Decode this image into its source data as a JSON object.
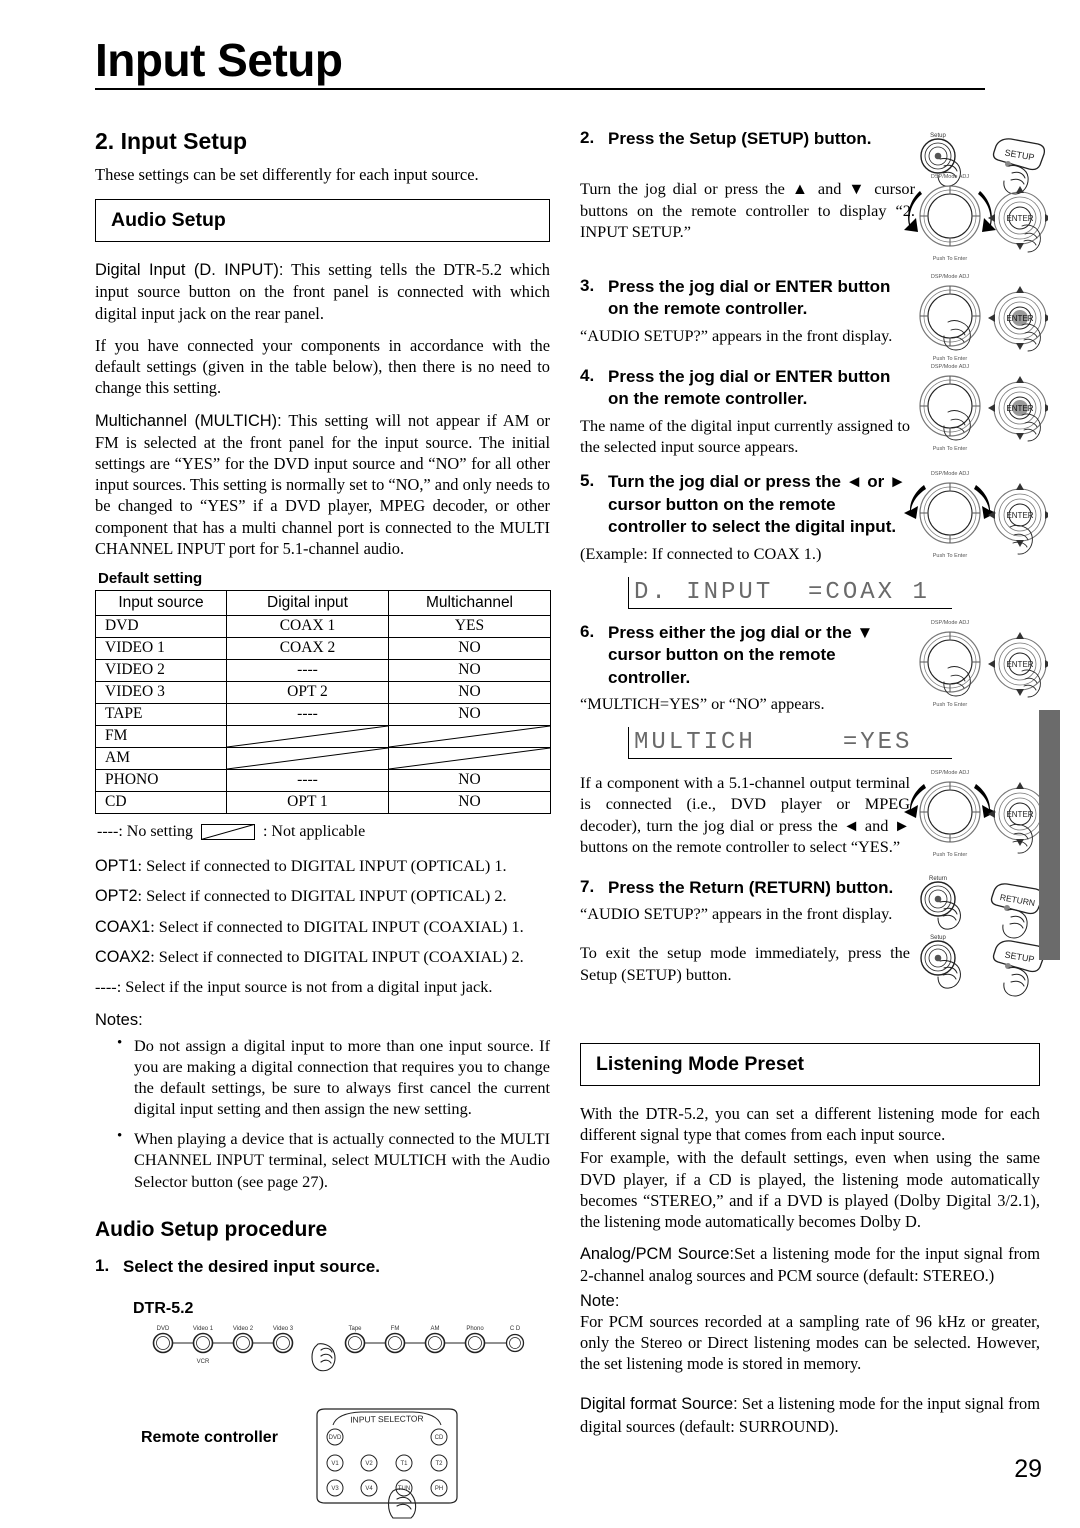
{
  "masthead": {
    "title": "Input Setup"
  },
  "left": {
    "section_title": "2. Input Setup",
    "section_lead": "These settings can be set differently for each input source.",
    "audio_setup_box": "Audio Setup",
    "para_digital_input_term": "Digital Input (D. INPUT):",
    "para_digital_input": " This setting tells the DTR-5.2 which input source button on the front panel is connected with which digital input jack on the rear panel.",
    "para_default": "If you have connected your components in accordance with the default settings (given in the table below), then there is no need to change this setting.",
    "para_multich_term": "Multichannel (MULTICH):",
    "para_multich": " This setting will not appear if AM or FM is selected at the front panel for the input source. The initial settings are “YES” for the DVD input source and “NO” for all other input sources. This setting is normally set to “NO,” and only needs to be changed to “YES” if a DVD player, MPEG decoder, or other component that has a multi channel port is connected to the MULTI CHANNEL INPUT port for 5.1-channel audio.",
    "table": {
      "caption": "Default setting",
      "headers": [
        "Input source",
        "Digital input",
        "Multichannel"
      ],
      "rows": [
        {
          "source": "DVD",
          "digital": "COAX 1",
          "multich": "YES",
          "na": false
        },
        {
          "source": "VIDEO 1",
          "digital": "COAX 2",
          "multich": "NO",
          "na": false
        },
        {
          "source": "VIDEO 2",
          "digital": "----",
          "multich": "NO",
          "na": false
        },
        {
          "source": "VIDEO 3",
          "digital": "OPT 2",
          "multich": "NO",
          "na": false
        },
        {
          "source": "TAPE",
          "digital": "----",
          "multich": "NO",
          "na": false
        },
        {
          "source": "FM",
          "digital": "",
          "multich": "",
          "na": true
        },
        {
          "source": "AM",
          "digital": "",
          "multich": "",
          "na": true
        },
        {
          "source": "PHONO",
          "digital": "----",
          "multich": "NO",
          "na": false
        },
        {
          "source": "CD",
          "digital": "OPT 1",
          "multich": "NO",
          "na": false
        }
      ]
    },
    "legend_no_setting": "----: No setting",
    "legend_not_applicable": ": Not applicable",
    "definitions": [
      {
        "label": "OPT1",
        "text": ": Select if connected to DIGITAL INPUT (OPTICAL) 1."
      },
      {
        "label": "OPT2",
        "text": ": Select if connected to DIGITAL INPUT (OPTICAL) 2."
      },
      {
        "label": "COAX1",
        "text": ": Select if connected to DIGITAL INPUT (COAXIAL) 1."
      },
      {
        "label": "COAX2",
        "text": ": Select if connected to DIGITAL INPUT (COAXIAL) 2."
      },
      {
        "label": "----",
        "text": ": Select if the input source is not from a digital input jack."
      }
    ],
    "notes_heading": "Notes:",
    "notes": [
      "Do not assign a digital input to more than one input source. If you are making a digital connection that requires you to change the default settings, be sure to always first cancel the current digital input setting and then assign the new setting.",
      "When playing a device that is actually connected to the MULTI CHANNEL INPUT terminal, select MULTICH with the Audio Selector button (see page 27)."
    ],
    "procedure_heading": "Audio Setup procedure",
    "step1": {
      "num": "1.",
      "text": "Select the desired input source."
    },
    "device_label": "DTR-5.2",
    "device_buttons_row": [
      "DVD",
      "Video 1",
      "Video 2",
      "Video 3",
      "Tape",
      "FM",
      "AM",
      "Phono",
      "CD"
    ],
    "device_sub_label": "VCR",
    "remote_label": "Remote controller",
    "remote_title": "INPUT SELECTOR",
    "remote_buttons": [
      "DVD",
      "CD",
      "V1",
      "V2",
      "T1",
      "T2",
      "V3",
      "V4",
      "TUN",
      "PH"
    ]
  },
  "right": {
    "step2": {
      "num": "2.",
      "text": "Press the Setup (SETUP) button."
    },
    "step2_sub": "Turn the jog dial or press the ▲ and ▼ cursor buttons on the remote controller to display “2. INPUT SETUP.”",
    "step3": {
      "num": "3.",
      "text": "Press the jog dial or ENTER button on the remote controller."
    },
    "step3_sub": "“AUDIO SETUP?” appears in the front display.",
    "step4": {
      "num": "4.",
      "text": "Press the jog dial or ENTER button on the remote controller."
    },
    "step4_sub": "The name of the digital input currently assigned to the selected input source appears.",
    "step5": {
      "num": "5.",
      "text": "Turn the jog dial or press the ◄ or ► cursor button on the remote controller to select the digital input."
    },
    "step5_sub": "(Example: If connected to COAX 1.)",
    "lcd_1": "D. INPUT  =COAX 1",
    "step6": {
      "num": "6.",
      "text": "Press either the jog dial or the ▼ cursor button on the remote controller."
    },
    "step6_sub": "“MULTICH=YES” or “NO” appears.",
    "lcd_2": "MULTICH     =YES",
    "step6_sub2": "If a component with a 5.1-channel output terminal is connected (i.e., DVD player or MPEG decoder), turn the jog dial or press the ◄ and ► buttons on the remote controller to select “YES.”",
    "step7": {
      "num": "7.",
      "text": "Press the Return (RETURN) button."
    },
    "step7_sub": "“AUDIO SETUP?” appears in the front display.",
    "step7_sub2": "To exit the setup mode immediately, press the Setup (SETUP) button.",
    "listening_box": "Listening Mode Preset",
    "lm_para1": "With the DTR-5.2, you can set a different listening mode for each different signal type that comes from each input source.",
    "lm_para2": "For example, with the default settings, even when using the same DVD player, if a CD is played, the listening mode automatically becomes “STEREO,” and if a DVD is played (Dolby Digital 3/2.1), the listening mode automatically becomes Dolby D.",
    "lm_analog_term": "Analog/PCM Source:",
    "lm_analog": "Set a listening mode for the input signal from 2-channel analog sources and PCM source (default: STEREO.)",
    "lm_note_heading": "Note:",
    "lm_note": "For PCM sources recorded at a sampling rate of 96 kHz or greater, only the Stereo or Direct listening modes can be selected. However, the set listening mode is stored in memory.",
    "lm_digital_term": "Digital format Source:",
    "lm_digital": " Set a listening mode for the input signal from digital sources (default: SURROUND).",
    "jog_label_top": "DSP/Mode ADJ",
    "jog_label_bottom": "Push To Enter",
    "enter_label": "ENTER",
    "setup_knob_label": "Setup",
    "setup_button_label": "SETUP",
    "return_knob_label": "Return",
    "return_button_label": "RETURN"
  },
  "page_number": "29"
}
